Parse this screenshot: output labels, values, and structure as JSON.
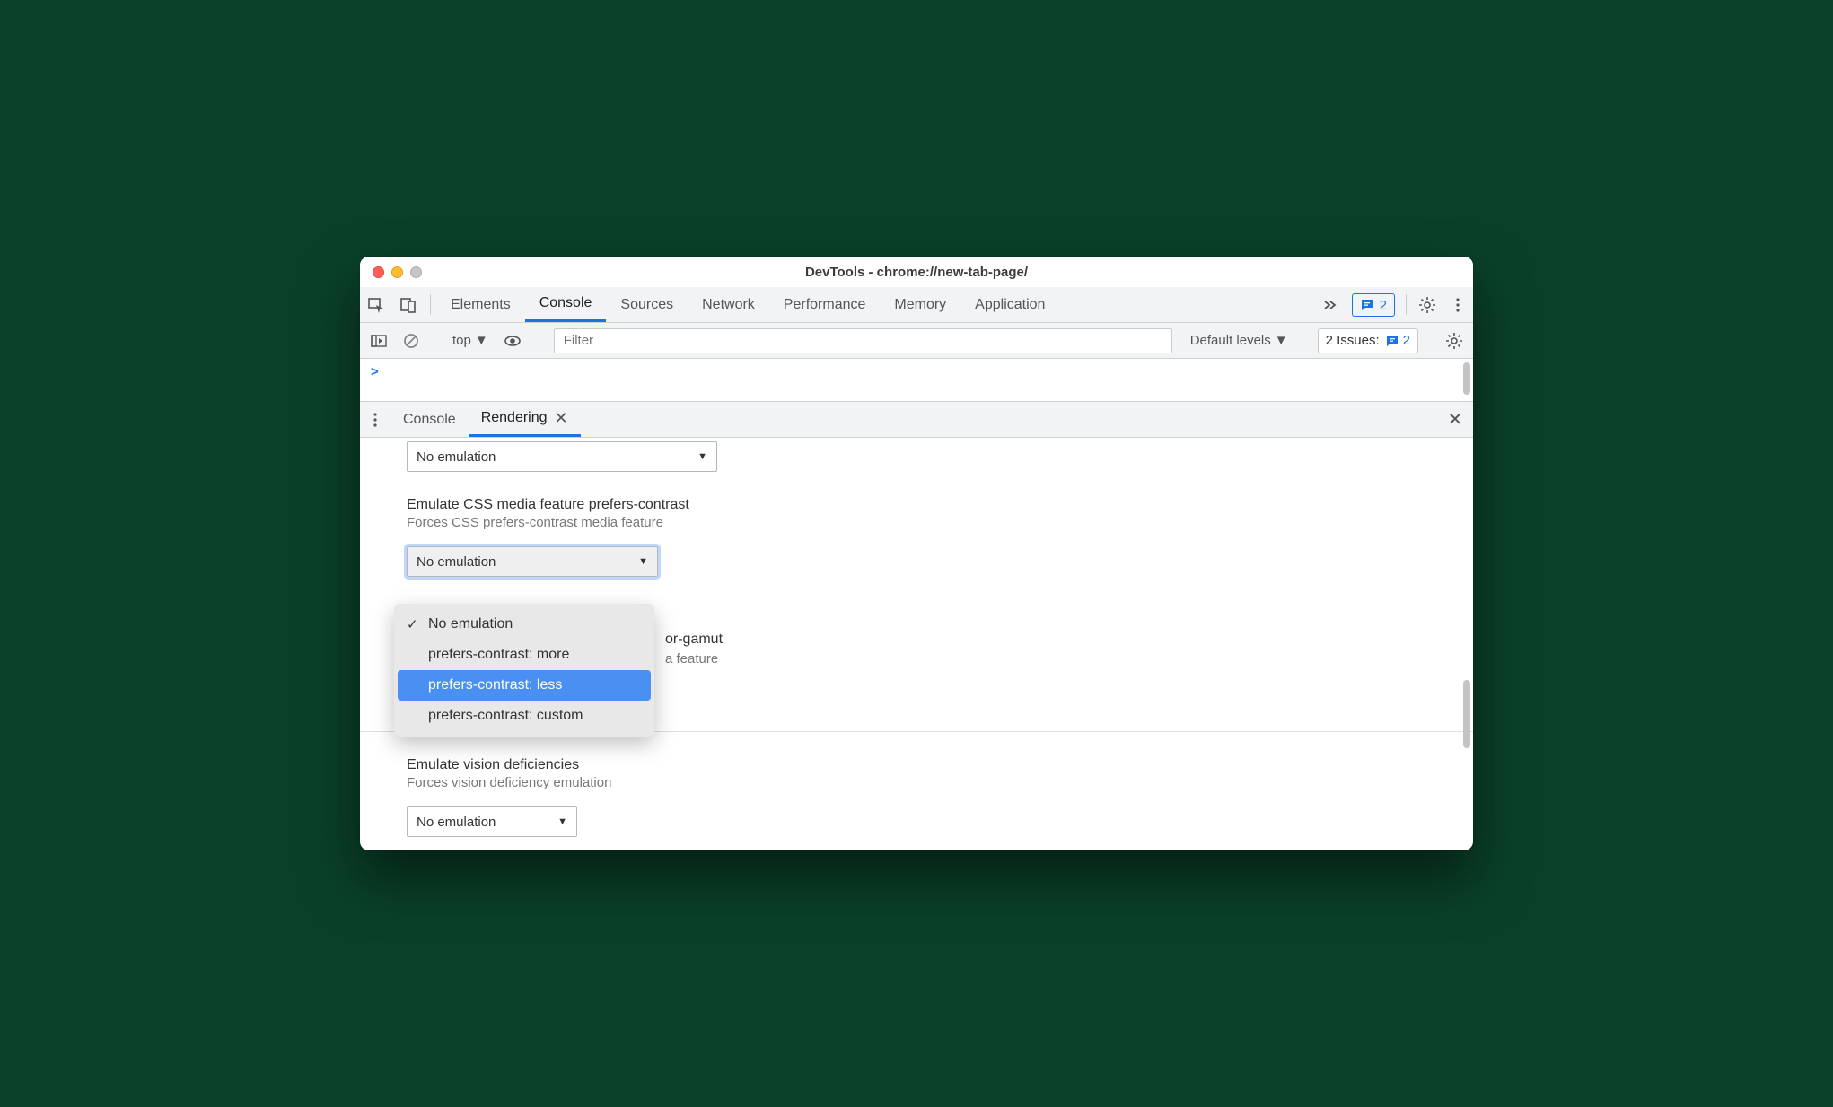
{
  "window_title": "DevTools - chrome://new-tab-page/",
  "main_tabs": {
    "items": [
      "Elements",
      "Console",
      "Sources",
      "Network",
      "Performance",
      "Memory",
      "Application"
    ],
    "active": "Console",
    "badge_count": "2"
  },
  "console_toolbar": {
    "context": "top",
    "filter_placeholder": "Filter",
    "levels": "Default levels",
    "issues_label": "2 Issues:",
    "issues_count": "2"
  },
  "console_prompt": ">",
  "drawer": {
    "tabs": [
      "Console",
      "Rendering"
    ],
    "active": "Rendering"
  },
  "rendering": {
    "top_select_value": "No emulation",
    "contrast": {
      "title": "Emulate CSS media feature prefers-contrast",
      "subtitle": "Forces CSS prefers-contrast media feature",
      "select_value": "No emulation",
      "options": [
        "No emulation",
        "prefers-contrast: more",
        "prefers-contrast: less",
        "prefers-contrast: custom"
      ],
      "checked_index": 0,
      "hover_index": 2
    },
    "gamut": {
      "title_visible_tail": "or-gamut",
      "subtitle_visible_tail": "a feature"
    },
    "vision": {
      "title": "Emulate vision deficiencies",
      "subtitle": "Forces vision deficiency emulation",
      "select_value": "No emulation"
    }
  }
}
